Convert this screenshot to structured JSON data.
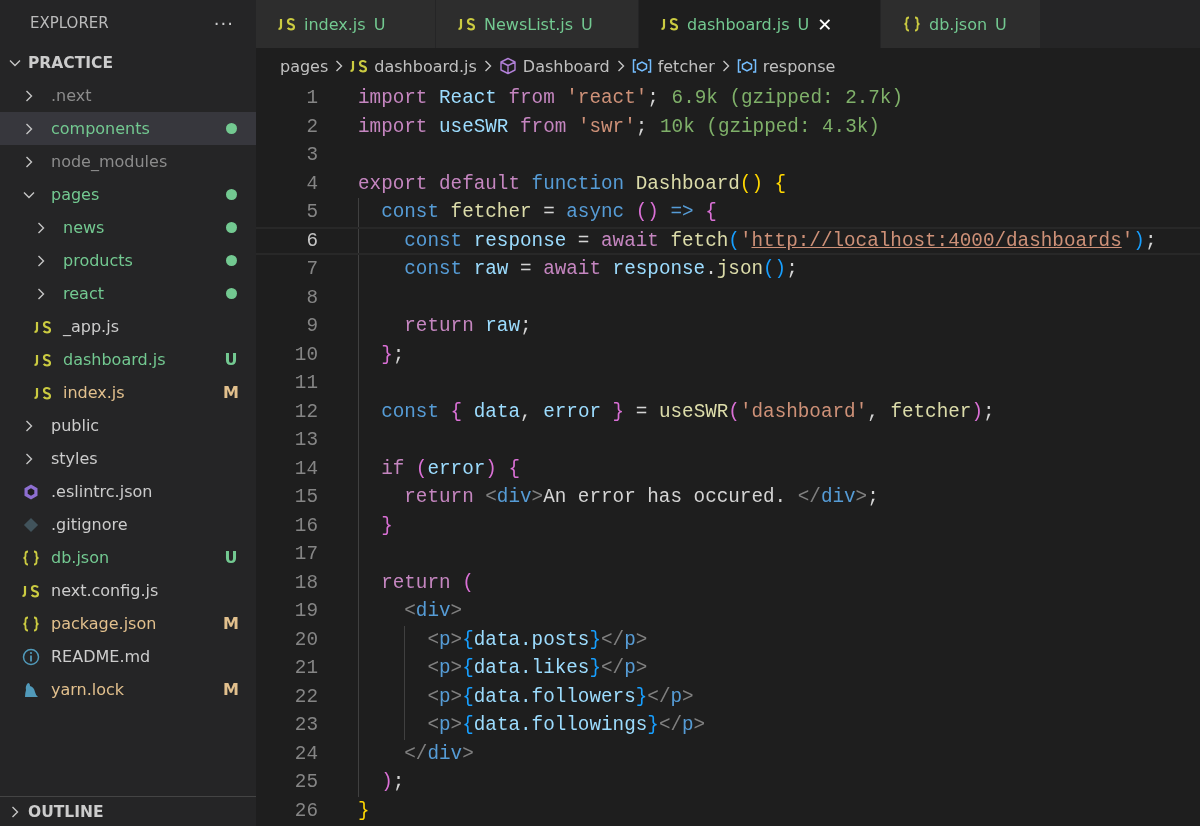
{
  "sidebar": {
    "title": "EXPLORER",
    "more": "···",
    "root": {
      "name": "PRACTICE",
      "expanded": true,
      "children": [
        {
          "name": ".next",
          "kind": "folder",
          "expanded": false,
          "color": "#8c8c8c",
          "changes": false,
          "selected": false
        },
        {
          "name": "components",
          "kind": "folder",
          "expanded": false,
          "color": "#73c991",
          "changes": true,
          "selected": true
        },
        {
          "name": "node_modules",
          "kind": "folder",
          "expanded": false,
          "color": "#8c8c8c",
          "changes": false,
          "selected": false
        },
        {
          "name": "pages",
          "kind": "folder",
          "expanded": true,
          "color": "#73c991",
          "changes": true,
          "selected": false,
          "children": [
            {
              "name": "news",
              "kind": "folder",
              "expanded": false,
              "color": "#73c991",
              "changes": true,
              "selected": false
            },
            {
              "name": "products",
              "kind": "folder",
              "expanded": false,
              "color": "#73c991",
              "changes": true,
              "selected": false
            },
            {
              "name": "react",
              "kind": "folder",
              "expanded": false,
              "color": "#73c991",
              "changes": true,
              "selected": false
            },
            {
              "name": "_app.js",
              "kind": "js",
              "color": "#cccccc",
              "selected": false
            },
            {
              "name": "dashboard.js",
              "kind": "js",
              "color": "#73c991",
              "status": "U",
              "selected": false
            },
            {
              "name": "index.js",
              "kind": "js",
              "color": "#e2c08d",
              "status": "M",
              "selected": false
            }
          ]
        },
        {
          "name": "public",
          "kind": "folder",
          "expanded": false,
          "color": "#cccccc",
          "changes": false,
          "selected": false
        },
        {
          "name": "styles",
          "kind": "folder",
          "expanded": false,
          "color": "#cccccc",
          "changes": false,
          "selected": false
        },
        {
          "name": ".eslintrc.json",
          "kind": "eslint",
          "color": "#cccccc",
          "selected": false
        },
        {
          "name": ".gitignore",
          "kind": "git",
          "color": "#cccccc",
          "selected": false
        },
        {
          "name": "db.json",
          "kind": "json",
          "color": "#73c991",
          "status": "U",
          "selected": false
        },
        {
          "name": "next.config.js",
          "kind": "js",
          "color": "#cccccc",
          "selected": false
        },
        {
          "name": "package.json",
          "kind": "json",
          "color": "#e2c08d",
          "status": "M",
          "selected": false
        },
        {
          "name": "README.md",
          "kind": "info",
          "color": "#cccccc",
          "selected": false
        },
        {
          "name": "yarn.lock",
          "kind": "yarn",
          "color": "#e2c08d",
          "status": "M",
          "selected": false
        }
      ]
    },
    "outline": {
      "name": "OUTLINE",
      "expanded": false
    }
  },
  "tabs": [
    {
      "label": "index.js",
      "kind": "js",
      "status": "U",
      "selected": false
    },
    {
      "label": "NewsList.js",
      "kind": "js",
      "status": "U",
      "selected": false
    },
    {
      "label": "dashboard.js",
      "kind": "js",
      "status": "U",
      "selected": true,
      "close": "✕"
    },
    {
      "label": "db.json",
      "kind": "json",
      "status": "U",
      "selected": false
    }
  ],
  "breadcrumb": [
    {
      "label": "pages",
      "kind": "folder"
    },
    {
      "label": "dashboard.js",
      "kind": "js"
    },
    {
      "label": "Dashboard",
      "kind": "class"
    },
    {
      "label": "fetcher",
      "kind": "variable"
    },
    {
      "label": "response",
      "kind": "variable"
    }
  ],
  "editor": {
    "lines": [
      {
        "number": "1",
        "current": false,
        "tokens": [
          {
            "kind": "kw",
            "text": "import "
          },
          {
            "kind": "var",
            "text": "React"
          },
          {
            "kind": "kw",
            "text": " from "
          },
          {
            "kind": "str",
            "text": "'react'"
          },
          {
            "kind": "pun",
            "text": ";"
          }
        ],
        "hint": "6.9k (gzipped: 2.7k)"
      },
      {
        "number": "2",
        "current": false,
        "tokens": [
          {
            "kind": "kw",
            "text": "import "
          },
          {
            "kind": "var",
            "text": "useSWR"
          },
          {
            "kind": "kw",
            "text": " from "
          },
          {
            "kind": "str",
            "text": "'swr'"
          },
          {
            "kind": "pun",
            "text": ";"
          }
        ],
        "hint": "10k (gzipped: 4.3k)"
      },
      {
        "number": "3",
        "current": false
      },
      {
        "number": "4",
        "current": false,
        "tokens": [
          {
            "kind": "kw",
            "text": "export default "
          },
          {
            "kind": "st",
            "text": "function "
          },
          {
            "kind": "fn",
            "text": "Dashboard"
          },
          {
            "kind": "br1",
            "text": "() {"
          }
        ]
      },
      {
        "number": "5",
        "current": false,
        "tokens": [
          {
            "kind": "st",
            "text": "  const "
          },
          {
            "kind": "fn",
            "text": "fetcher"
          },
          {
            "kind": "pun",
            "text": " = "
          },
          {
            "kind": "st",
            "text": "async "
          },
          {
            "kind": "br2",
            "text": "()"
          },
          {
            "kind": "st",
            "text": " => "
          },
          {
            "kind": "br2",
            "text": "{"
          }
        ]
      },
      {
        "number": "6",
        "current": true,
        "tokens": [
          {
            "kind": "st",
            "text": "    const "
          },
          {
            "kind": "var",
            "text": "response"
          },
          {
            "kind": "pun",
            "text": " = "
          },
          {
            "kind": "kw",
            "text": "await "
          },
          {
            "kind": "fn",
            "text": "fetch"
          },
          {
            "kind": "br3",
            "text": "("
          },
          {
            "kind": "str",
            "text": "'"
          },
          {
            "kind": "link",
            "text": "http://localhost:4000/dashboards"
          },
          {
            "kind": "str",
            "text": "'"
          },
          {
            "kind": "br3",
            "text": ")"
          },
          {
            "kind": "pun",
            "text": ";"
          }
        ]
      },
      {
        "number": "7",
        "current": false,
        "tokens": [
          {
            "kind": "st",
            "text": "    const "
          },
          {
            "kind": "var",
            "text": "raw"
          },
          {
            "kind": "pun",
            "text": " = "
          },
          {
            "kind": "kw",
            "text": "await "
          },
          {
            "kind": "var",
            "text": "response"
          },
          {
            "kind": "pun",
            "text": "."
          },
          {
            "kind": "fn",
            "text": "json"
          },
          {
            "kind": "br3",
            "text": "()"
          },
          {
            "kind": "pun",
            "text": ";"
          }
        ]
      },
      {
        "number": "8",
        "current": false
      },
      {
        "number": "9",
        "current": false,
        "tokens": [
          {
            "kind": "kw",
            "text": "    return "
          },
          {
            "kind": "var",
            "text": "raw"
          },
          {
            "kind": "pun",
            "text": ";"
          }
        ]
      },
      {
        "number": "10",
        "current": false,
        "tokens": [
          {
            "kind": "br2",
            "text": "  }"
          },
          {
            "kind": "pun",
            "text": ";"
          }
        ]
      },
      {
        "number": "11",
        "current": false
      },
      {
        "number": "12",
        "current": false,
        "tokens": [
          {
            "kind": "st",
            "text": "  const "
          },
          {
            "kind": "br2",
            "text": "{ "
          },
          {
            "kind": "var",
            "text": "data"
          },
          {
            "kind": "pun",
            "text": ", "
          },
          {
            "kind": "var",
            "text": "error"
          },
          {
            "kind": "br2",
            "text": " }"
          },
          {
            "kind": "pun",
            "text": " = "
          },
          {
            "kind": "fn",
            "text": "useSWR"
          },
          {
            "kind": "br2",
            "text": "("
          },
          {
            "kind": "str",
            "text": "'dashboard'"
          },
          {
            "kind": "pun",
            "text": ", "
          },
          {
            "kind": "fn",
            "text": "fetcher"
          },
          {
            "kind": "br2",
            "text": ")"
          },
          {
            "kind": "pun",
            "text": ";"
          }
        ]
      },
      {
        "number": "13",
        "current": false
      },
      {
        "number": "14",
        "current": false,
        "tokens": [
          {
            "kind": "kw",
            "text": "  if "
          },
          {
            "kind": "br2",
            "text": "("
          },
          {
            "kind": "var",
            "text": "error"
          },
          {
            "kind": "br2",
            "text": ") {"
          }
        ]
      },
      {
        "number": "15",
        "current": false,
        "tokens": [
          {
            "kind": "kw",
            "text": "    return "
          },
          {
            "kind": "tag",
            "text": "<"
          },
          {
            "kind": "st",
            "text": "div"
          },
          {
            "kind": "tag",
            "text": ">"
          },
          {
            "kind": "txt",
            "text": "An error has occured. "
          },
          {
            "kind": "tag",
            "text": "</"
          },
          {
            "kind": "st",
            "text": "div"
          },
          {
            "kind": "tag",
            "text": ">"
          },
          {
            "kind": "pun",
            "text": ";"
          }
        ]
      },
      {
        "number": "16",
        "current": false,
        "tokens": [
          {
            "kind": "br2",
            "text": "  }"
          }
        ]
      },
      {
        "number": "17",
        "current": false
      },
      {
        "number": "18",
        "current": false,
        "tokens": [
          {
            "kind": "kw",
            "text": "  return "
          },
          {
            "kind": "br2",
            "text": "("
          }
        ]
      },
      {
        "number": "19",
        "current": false,
        "tokens": [
          {
            "kind": "tag",
            "text": "    <"
          },
          {
            "kind": "st",
            "text": "div"
          },
          {
            "kind": "tag",
            "text": ">"
          }
        ]
      },
      {
        "number": "20",
        "current": false,
        "tokens": [
          {
            "kind": "tag",
            "text": "      <"
          },
          {
            "kind": "st",
            "text": "p"
          },
          {
            "kind": "tag",
            "text": ">"
          },
          {
            "kind": "br3",
            "text": "{"
          },
          {
            "kind": "var",
            "text": "data.posts"
          },
          {
            "kind": "br3",
            "text": "}"
          },
          {
            "kind": "tag",
            "text": "</"
          },
          {
            "kind": "st",
            "text": "p"
          },
          {
            "kind": "tag",
            "text": ">"
          }
        ]
      },
      {
        "number": "21",
        "current": false,
        "tokens": [
          {
            "kind": "tag",
            "text": "      <"
          },
          {
            "kind": "st",
            "text": "p"
          },
          {
            "kind": "tag",
            "text": ">"
          },
          {
            "kind": "br3",
            "text": "{"
          },
          {
            "kind": "var",
            "text": "data.likes"
          },
          {
            "kind": "br3",
            "text": "}"
          },
          {
            "kind": "tag",
            "text": "</"
          },
          {
            "kind": "st",
            "text": "p"
          },
          {
            "kind": "tag",
            "text": ">"
          }
        ]
      },
      {
        "number": "22",
        "current": false,
        "tokens": [
          {
            "kind": "tag",
            "text": "      <"
          },
          {
            "kind": "st",
            "text": "p"
          },
          {
            "kind": "tag",
            "text": ">"
          },
          {
            "kind": "br3",
            "text": "{"
          },
          {
            "kind": "var",
            "text": "data.followers"
          },
          {
            "kind": "br3",
            "text": "}"
          },
          {
            "kind": "tag",
            "text": "</"
          },
          {
            "kind": "st",
            "text": "p"
          },
          {
            "kind": "tag",
            "text": ">"
          }
        ]
      },
      {
        "number": "23",
        "current": false,
        "tokens": [
          {
            "kind": "tag",
            "text": "      <"
          },
          {
            "kind": "st",
            "text": "p"
          },
          {
            "kind": "tag",
            "text": ">"
          },
          {
            "kind": "br3",
            "text": "{"
          },
          {
            "kind": "var",
            "text": "data.followings"
          },
          {
            "kind": "br3",
            "text": "}"
          },
          {
            "kind": "tag",
            "text": "</"
          },
          {
            "kind": "st",
            "text": "p"
          },
          {
            "kind": "tag",
            "text": ">"
          }
        ]
      },
      {
        "number": "24",
        "current": false,
        "tokens": [
          {
            "kind": "tag",
            "text": "    </"
          },
          {
            "kind": "st",
            "text": "div"
          },
          {
            "kind": "tag",
            "text": ">"
          }
        ]
      },
      {
        "number": "25",
        "current": false,
        "tokens": [
          {
            "kind": "br2",
            "text": "  )"
          },
          {
            "kind": "pun",
            "text": ";"
          }
        ]
      },
      {
        "number": "26",
        "current": false,
        "tokens": [
          {
            "kind": "br1",
            "text": "}"
          }
        ]
      }
    ]
  }
}
